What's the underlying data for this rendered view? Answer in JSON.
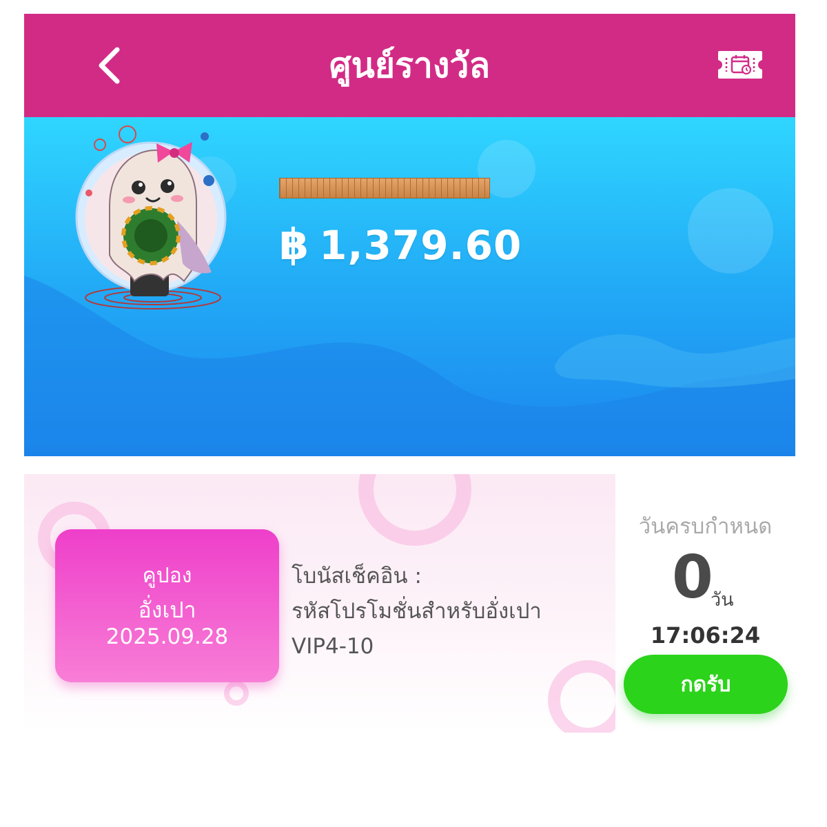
{
  "header": {
    "title": "ศูนย์รางวัล",
    "back_icon": "chevron-left-icon",
    "right_icon": "ticket-calendar-icon"
  },
  "banner": {
    "currency_symbol": "฿",
    "balance": "1,379.60"
  },
  "coupon": {
    "type_label": "คูปอง",
    "name": "อั่งเปา",
    "date": "2025.09.28",
    "description_lines": [
      "โบนัสเช็คอิน :",
      "รหัสโปรโมชั่นสำหรับอั่งเปา",
      "VIP4-10"
    ]
  },
  "deadline": {
    "label": "วันครบกำหนด",
    "days": "0",
    "days_unit": "วัน",
    "time": "17:06:24",
    "claim_label": "กดรับ"
  },
  "colors": {
    "header": "#d22b86",
    "banner_top": "#2fd6ff",
    "banner_bottom": "#1b86ee",
    "coupon_tag": "#ee3fca",
    "claim_button": "#2bd31a"
  }
}
